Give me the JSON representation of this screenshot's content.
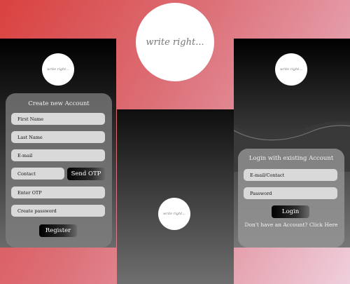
{
  "brand": {
    "logo_text": "write right..."
  },
  "register": {
    "title": "Create new Account",
    "fields": {
      "first_name": "First Name",
      "last_name": "Last Name",
      "email": "E-mail",
      "contact": "Contact",
      "otp": "Enter OTP",
      "password": "Create password"
    },
    "send_otp_label": "Send OTP",
    "register_label": "Register"
  },
  "login": {
    "title": "Login with existing Account",
    "fields": {
      "email_contact": "E-mail/Contact",
      "password": "Password"
    },
    "login_label": "Login",
    "no_account_text": "Don't have an Account?",
    "click_here_label": "Click Here"
  },
  "colors": {
    "background_start": "#d9423f",
    "background_end": "#efcfdc",
    "panel_dark": "#000000",
    "field_bg": "#d9d9d9"
  }
}
